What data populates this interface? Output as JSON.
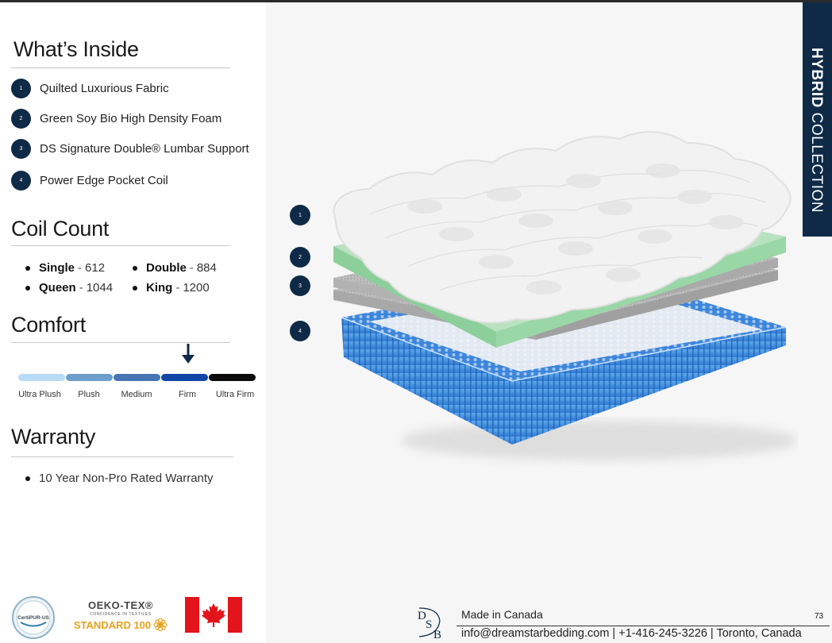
{
  "sections": {
    "whats_inside": "What’s Inside",
    "coil_count": "Coil Count",
    "comfort": "Comfort",
    "warranty": "Warranty"
  },
  "layers": [
    {
      "num": "1",
      "label": "Quilted Luxurious Fabric"
    },
    {
      "num": "2",
      "label": "Green Soy Bio High Density Foam"
    },
    {
      "num": "3",
      "label": "DS Signature Double® Lumbar Support"
    },
    {
      "num": "4",
      "label": "Power Edge Pocket Coil"
    }
  ],
  "coils": [
    {
      "size": "Single",
      "count": "612"
    },
    {
      "size": "Double",
      "count": "884"
    },
    {
      "size": "Queen",
      "count": "1044"
    },
    {
      "size": "King",
      "count": "1200"
    }
  ],
  "coil_separator": "-",
  "comfort_scale": {
    "labels": [
      "Ultra Plush",
      "Plush",
      "Medium",
      "Firm",
      "Ultra Firm"
    ],
    "colors": [
      "#b9dbf5",
      "#6c9fcb",
      "#4575b3",
      "#1146a6",
      "#0b0b0b"
    ],
    "selected": "Firm"
  },
  "warranty_items": [
    "10 Year Non-Pro Rated Warranty"
  ],
  "logos": {
    "certipur_text": "CertiPUR-US",
    "oeko_title": "OEKO-TEX®",
    "oeko_sub": "CONFIDENCE IN TEXTILES",
    "oeko_standard": "STANDARD 100"
  },
  "collection": {
    "bold": "HYBRID",
    "light": " COLLECTION"
  },
  "callouts": [
    "1",
    "2",
    "3",
    "4"
  ],
  "footer": {
    "made_in": "Made in Canada",
    "contact": "info@dreamstarbedding.com | +1-416-245-3226 | Toronto, Canada",
    "page_number": "73",
    "logo_letters": "DSB"
  },
  "colors": {
    "navy": "#0e2a47",
    "foam_green": "#a9d9b2",
    "coil_blue": "#3f8fe0"
  }
}
